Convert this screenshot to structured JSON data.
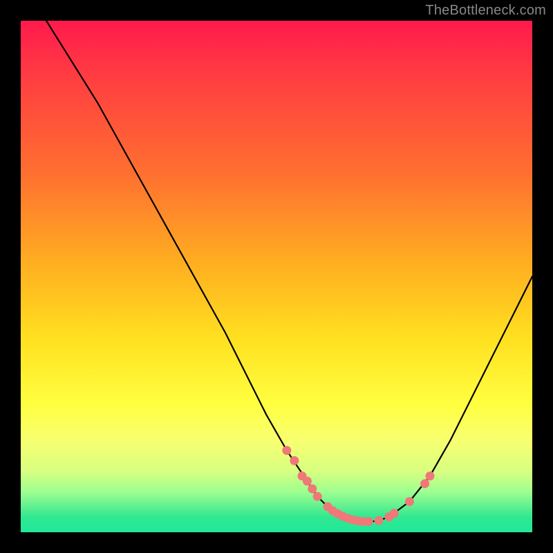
{
  "watermark": "TheBottleneck.com",
  "chart_data": {
    "type": "line",
    "title": "",
    "xlabel": "",
    "ylabel": "",
    "xlim": [
      0,
      100
    ],
    "ylim": [
      0,
      100
    ],
    "series": [
      {
        "name": "bottleneck-curve",
        "x": [
          0,
          5,
          10,
          15,
          20,
          25,
          30,
          35,
          40,
          44,
          48,
          52,
          56,
          58,
          60,
          62,
          64,
          66,
          68,
          70,
          72,
          76,
          80,
          84,
          88,
          92,
          96,
          100
        ],
        "y": [
          108,
          100,
          92,
          84,
          75,
          66,
          57,
          48,
          39,
          31,
          23,
          16,
          10,
          7,
          5,
          3.5,
          2.5,
          2,
          2,
          2.3,
          3,
          6,
          11,
          18,
          26,
          34,
          42,
          50
        ]
      }
    ],
    "points": {
      "name": "highlight-dots",
      "color": "#f07878",
      "x": [
        52,
        53.5,
        55,
        56,
        57,
        58,
        60,
        61,
        62,
        63,
        64,
        65,
        66,
        67,
        68,
        70,
        72,
        73,
        76,
        79,
        80
      ],
      "y": [
        16,
        14,
        11,
        10,
        8.5,
        7,
        5,
        4.2,
        3.6,
        3.1,
        2.7,
        2.4,
        2.2,
        2.1,
        2.1,
        2.3,
        3,
        3.7,
        6,
        9.5,
        11
      ]
    },
    "gradient_stops": [
      {
        "pos": 0,
        "color": "#ff1a4d"
      },
      {
        "pos": 30,
        "color": "#ff7030"
      },
      {
        "pos": 62,
        "color": "#ffe020"
      },
      {
        "pos": 82,
        "color": "#f8ff70"
      },
      {
        "pos": 95,
        "color": "#60f090"
      },
      {
        "pos": 100,
        "color": "#20e89a"
      }
    ]
  }
}
